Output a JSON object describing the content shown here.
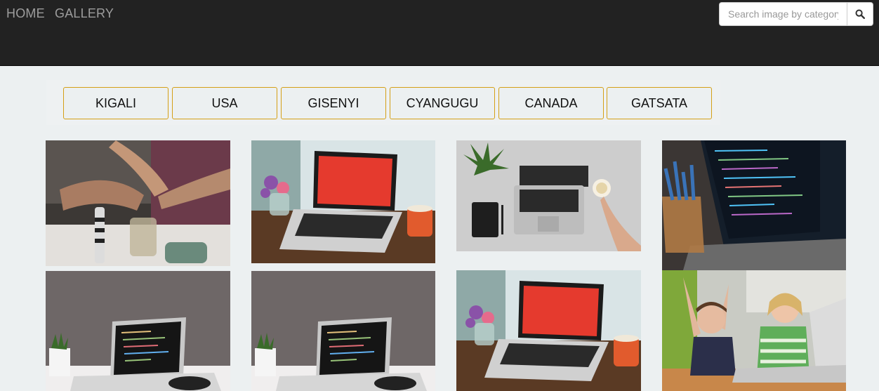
{
  "nav": {
    "home_label": "HOME",
    "gallery_label": "GALLERY"
  },
  "search": {
    "placeholder": "Search image by category",
    "button_icon": "search-icon"
  },
  "categories": [
    "KIGALI",
    "USA",
    "GISENYI",
    "CYANGUGU",
    "CANADA",
    "GATSATA"
  ],
  "gallery": [
    {
      "subject": "team-hands-photo"
    },
    {
      "subject": "red-screen-laptop-photo"
    },
    {
      "subject": "laptop-desk-topview-photo"
    },
    {
      "subject": "code-laptop-pencils-photo"
    },
    {
      "subject": "code-laptop-plant-photo"
    },
    {
      "subject": "code-laptop-plant-photo"
    },
    {
      "subject": "red-screen-laptop-photo"
    },
    {
      "subject": "kids-laptop-photo"
    }
  ],
  "colors": {
    "navbar": "#222222",
    "nav_text": "#9d9d9d",
    "page_background": "#ecf0f1",
    "category_border": "#d4a017"
  }
}
